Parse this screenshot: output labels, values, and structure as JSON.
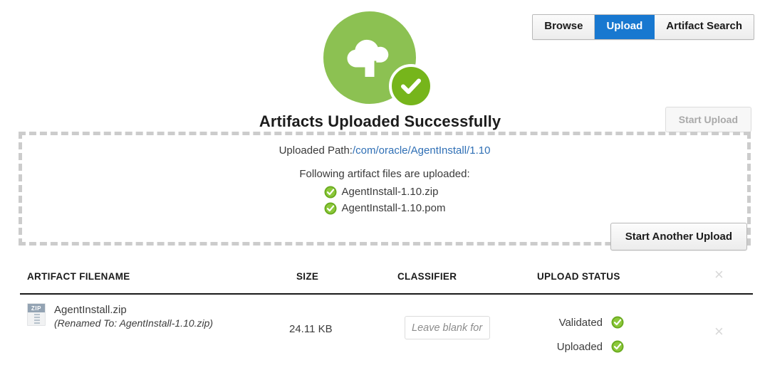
{
  "nav": {
    "tabs": [
      {
        "label": "Browse",
        "active": false
      },
      {
        "label": "Upload",
        "active": true
      },
      {
        "label": "Artifact Search",
        "active": false
      }
    ]
  },
  "hero": {
    "icon": "cloud-upload-success-icon",
    "title": "Artifacts Uploaded Successfully"
  },
  "buttons": {
    "start_upload": "Start Upload",
    "start_another_upload": "Start Another Upload"
  },
  "dropzone": {
    "uploaded_path_label": "Uploaded Path:",
    "uploaded_path_value": "/com/oracle/AgentInstall/1.10",
    "files_intro": "Following artifact files are uploaded:",
    "files": [
      "AgentInstall-1.10.zip",
      "AgentInstall-1.10.pom"
    ]
  },
  "table": {
    "headers": {
      "filename": "ARTIFACT FILENAME",
      "size": "SIZE",
      "classifier": "CLASSIFIER",
      "status": "UPLOAD STATUS",
      "close": "×"
    },
    "rows": [
      {
        "file_icon": "zip-file-icon",
        "file_icon_label": "ZIP",
        "filename": "AgentInstall.zip",
        "renamed_note": "(Renamed To: AgentInstall-1.10.zip)",
        "size": "24.11 KB",
        "classifier_value": "",
        "classifier_placeholder": "Leave blank for",
        "statuses": [
          {
            "label": "Validated",
            "state": "success"
          },
          {
            "label": "Uploaded",
            "state": "success"
          }
        ],
        "remove": "×"
      }
    ]
  },
  "colors": {
    "accent_blue": "#1878d0",
    "cloud_green": "#8cc152",
    "check_green": "#76b51b",
    "dash_border": "#cccccc",
    "path_link": "#2f6fb5"
  }
}
